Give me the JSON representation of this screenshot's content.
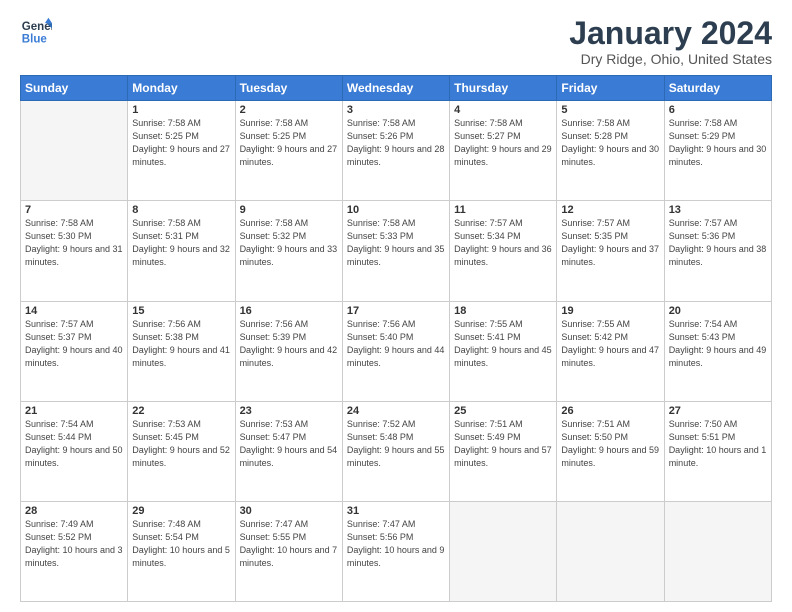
{
  "logo": {
    "line1": "General",
    "line2": "Blue"
  },
  "title": "January 2024",
  "location": "Dry Ridge, Ohio, United States",
  "weekdays": [
    "Sunday",
    "Monday",
    "Tuesday",
    "Wednesday",
    "Thursday",
    "Friday",
    "Saturday"
  ],
  "weeks": [
    [
      {
        "day": "",
        "sunrise": "",
        "sunset": "",
        "daylight": ""
      },
      {
        "day": "1",
        "sunrise": "Sunrise: 7:58 AM",
        "sunset": "Sunset: 5:25 PM",
        "daylight": "Daylight: 9 hours and 27 minutes."
      },
      {
        "day": "2",
        "sunrise": "Sunrise: 7:58 AM",
        "sunset": "Sunset: 5:25 PM",
        "daylight": "Daylight: 9 hours and 27 minutes."
      },
      {
        "day": "3",
        "sunrise": "Sunrise: 7:58 AM",
        "sunset": "Sunset: 5:26 PM",
        "daylight": "Daylight: 9 hours and 28 minutes."
      },
      {
        "day": "4",
        "sunrise": "Sunrise: 7:58 AM",
        "sunset": "Sunset: 5:27 PM",
        "daylight": "Daylight: 9 hours and 29 minutes."
      },
      {
        "day": "5",
        "sunrise": "Sunrise: 7:58 AM",
        "sunset": "Sunset: 5:28 PM",
        "daylight": "Daylight: 9 hours and 30 minutes."
      },
      {
        "day": "6",
        "sunrise": "Sunrise: 7:58 AM",
        "sunset": "Sunset: 5:29 PM",
        "daylight": "Daylight: 9 hours and 30 minutes."
      }
    ],
    [
      {
        "day": "7",
        "sunrise": "Sunrise: 7:58 AM",
        "sunset": "Sunset: 5:30 PM",
        "daylight": "Daylight: 9 hours and 31 minutes."
      },
      {
        "day": "8",
        "sunrise": "Sunrise: 7:58 AM",
        "sunset": "Sunset: 5:31 PM",
        "daylight": "Daylight: 9 hours and 32 minutes."
      },
      {
        "day": "9",
        "sunrise": "Sunrise: 7:58 AM",
        "sunset": "Sunset: 5:32 PM",
        "daylight": "Daylight: 9 hours and 33 minutes."
      },
      {
        "day": "10",
        "sunrise": "Sunrise: 7:58 AM",
        "sunset": "Sunset: 5:33 PM",
        "daylight": "Daylight: 9 hours and 35 minutes."
      },
      {
        "day": "11",
        "sunrise": "Sunrise: 7:57 AM",
        "sunset": "Sunset: 5:34 PM",
        "daylight": "Daylight: 9 hours and 36 minutes."
      },
      {
        "day": "12",
        "sunrise": "Sunrise: 7:57 AM",
        "sunset": "Sunset: 5:35 PM",
        "daylight": "Daylight: 9 hours and 37 minutes."
      },
      {
        "day": "13",
        "sunrise": "Sunrise: 7:57 AM",
        "sunset": "Sunset: 5:36 PM",
        "daylight": "Daylight: 9 hours and 38 minutes."
      }
    ],
    [
      {
        "day": "14",
        "sunrise": "Sunrise: 7:57 AM",
        "sunset": "Sunset: 5:37 PM",
        "daylight": "Daylight: 9 hours and 40 minutes."
      },
      {
        "day": "15",
        "sunrise": "Sunrise: 7:56 AM",
        "sunset": "Sunset: 5:38 PM",
        "daylight": "Daylight: 9 hours and 41 minutes."
      },
      {
        "day": "16",
        "sunrise": "Sunrise: 7:56 AM",
        "sunset": "Sunset: 5:39 PM",
        "daylight": "Daylight: 9 hours and 42 minutes."
      },
      {
        "day": "17",
        "sunrise": "Sunrise: 7:56 AM",
        "sunset": "Sunset: 5:40 PM",
        "daylight": "Daylight: 9 hours and 44 minutes."
      },
      {
        "day": "18",
        "sunrise": "Sunrise: 7:55 AM",
        "sunset": "Sunset: 5:41 PM",
        "daylight": "Daylight: 9 hours and 45 minutes."
      },
      {
        "day": "19",
        "sunrise": "Sunrise: 7:55 AM",
        "sunset": "Sunset: 5:42 PM",
        "daylight": "Daylight: 9 hours and 47 minutes."
      },
      {
        "day": "20",
        "sunrise": "Sunrise: 7:54 AM",
        "sunset": "Sunset: 5:43 PM",
        "daylight": "Daylight: 9 hours and 49 minutes."
      }
    ],
    [
      {
        "day": "21",
        "sunrise": "Sunrise: 7:54 AM",
        "sunset": "Sunset: 5:44 PM",
        "daylight": "Daylight: 9 hours and 50 minutes."
      },
      {
        "day": "22",
        "sunrise": "Sunrise: 7:53 AM",
        "sunset": "Sunset: 5:45 PM",
        "daylight": "Daylight: 9 hours and 52 minutes."
      },
      {
        "day": "23",
        "sunrise": "Sunrise: 7:53 AM",
        "sunset": "Sunset: 5:47 PM",
        "daylight": "Daylight: 9 hours and 54 minutes."
      },
      {
        "day": "24",
        "sunrise": "Sunrise: 7:52 AM",
        "sunset": "Sunset: 5:48 PM",
        "daylight": "Daylight: 9 hours and 55 minutes."
      },
      {
        "day": "25",
        "sunrise": "Sunrise: 7:51 AM",
        "sunset": "Sunset: 5:49 PM",
        "daylight": "Daylight: 9 hours and 57 minutes."
      },
      {
        "day": "26",
        "sunrise": "Sunrise: 7:51 AM",
        "sunset": "Sunset: 5:50 PM",
        "daylight": "Daylight: 9 hours and 59 minutes."
      },
      {
        "day": "27",
        "sunrise": "Sunrise: 7:50 AM",
        "sunset": "Sunset: 5:51 PM",
        "daylight": "Daylight: 10 hours and 1 minute."
      }
    ],
    [
      {
        "day": "28",
        "sunrise": "Sunrise: 7:49 AM",
        "sunset": "Sunset: 5:52 PM",
        "daylight": "Daylight: 10 hours and 3 minutes."
      },
      {
        "day": "29",
        "sunrise": "Sunrise: 7:48 AM",
        "sunset": "Sunset: 5:54 PM",
        "daylight": "Daylight: 10 hours and 5 minutes."
      },
      {
        "day": "30",
        "sunrise": "Sunrise: 7:47 AM",
        "sunset": "Sunset: 5:55 PM",
        "daylight": "Daylight: 10 hours and 7 minutes."
      },
      {
        "day": "31",
        "sunrise": "Sunrise: 7:47 AM",
        "sunset": "Sunset: 5:56 PM",
        "daylight": "Daylight: 10 hours and 9 minutes."
      },
      {
        "day": "",
        "sunrise": "",
        "sunset": "",
        "daylight": ""
      },
      {
        "day": "",
        "sunrise": "",
        "sunset": "",
        "daylight": ""
      },
      {
        "day": "",
        "sunrise": "",
        "sunset": "",
        "daylight": ""
      }
    ]
  ]
}
